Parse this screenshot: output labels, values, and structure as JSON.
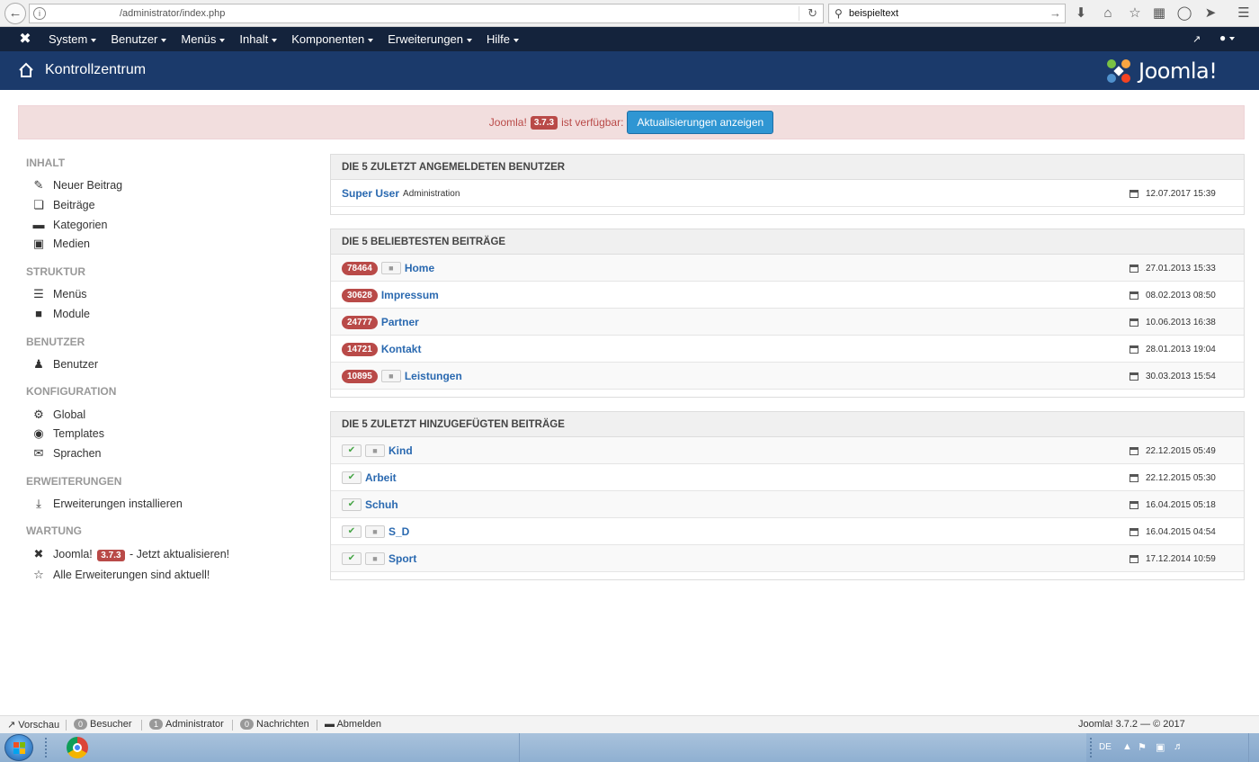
{
  "browser": {
    "url": "/administrator/index.php",
    "search_value": "beispieltext"
  },
  "navbar": {
    "items": [
      "System",
      "Benutzer",
      "Menüs",
      "Inhalt",
      "Komponenten",
      "Erweiterungen",
      "Hilfe"
    ]
  },
  "header": {
    "title": "Kontrollzentrum",
    "brand": "Joomla!"
  },
  "alert": {
    "prefix": "Joomla!",
    "version": "3.7.3",
    "suffix": "ist verfügbar:",
    "button": "Aktualisierungen anzeigen"
  },
  "sidebar": {
    "sections": [
      {
        "title": "INHALT",
        "items": [
          {
            "label": "Neuer Beitrag",
            "icon": "pencil-icon"
          },
          {
            "label": "Beiträge",
            "icon": "copy-icon"
          },
          {
            "label": "Kategorien",
            "icon": "folder-icon"
          },
          {
            "label": "Medien",
            "icon": "image-icon"
          }
        ]
      },
      {
        "title": "STRUKTUR",
        "items": [
          {
            "label": "Menüs",
            "icon": "list-icon"
          },
          {
            "label": "Module",
            "icon": "cube-icon"
          }
        ]
      },
      {
        "title": "BENUTZER",
        "items": [
          {
            "label": "Benutzer",
            "icon": "users-icon"
          }
        ]
      },
      {
        "title": "KONFIGURATION",
        "items": [
          {
            "label": "Global",
            "icon": "gear-icon"
          },
          {
            "label": "Templates",
            "icon": "eye-icon"
          },
          {
            "label": "Sprachen",
            "icon": "comments-icon"
          }
        ]
      },
      {
        "title": "ERWEITERUNGEN",
        "items": [
          {
            "label": "Erweiterungen installieren",
            "icon": "download-icon"
          }
        ]
      },
      {
        "title": "WARTUNG",
        "items": [
          {
            "label_prefix": "Joomla!",
            "version": "3.7.3",
            "label_suffix": "- Jetzt aktualisieren!",
            "icon": "joomla-icon"
          },
          {
            "label": "Alle Erweiterungen sind aktuell!",
            "icon": "star-icon"
          }
        ]
      }
    ]
  },
  "panels": {
    "logged_in": {
      "title": "DIE 5 ZULETZT ANGEMELDETEN BENUTZER",
      "rows": [
        {
          "name": "Super User",
          "sub": "Administration",
          "date": "12.07.2017 15:39"
        }
      ]
    },
    "popular": {
      "title": "DIE 5 BELIEBTESTEN BEITRÄGE",
      "rows": [
        {
          "hits": "78464",
          "locked": true,
          "title": "Home",
          "date": "27.01.2013 15:33"
        },
        {
          "hits": "30628",
          "locked": false,
          "title": "Impressum",
          "date": "08.02.2013 08:50"
        },
        {
          "hits": "24777",
          "locked": false,
          "title": "Partner",
          "date": "10.06.2013 16:38"
        },
        {
          "hits": "14721",
          "locked": false,
          "title": "Kontakt",
          "date": "28.01.2013 19:04"
        },
        {
          "hits": "10895",
          "locked": true,
          "title": "Leistungen",
          "date": "30.03.2013 15:54"
        }
      ]
    },
    "recent": {
      "title": "DIE 5 ZULETZT HINZUGEFÜGTEN BEITRÄGE",
      "rows": [
        {
          "locked": true,
          "title": "Kind",
          "date": "22.12.2015 05:49"
        },
        {
          "locked": false,
          "title": "Arbeit",
          "date": "22.12.2015 05:30"
        },
        {
          "locked": false,
          "title": "Schuh",
          "date": "16.04.2015 05:18"
        },
        {
          "locked": true,
          "title": "S_D",
          "date": "16.04.2015 04:54"
        },
        {
          "locked": true,
          "title": "Sport",
          "date": "17.12.2014 10:59"
        }
      ]
    }
  },
  "statusbar": {
    "preview": "Vorschau",
    "visitors_count": "0",
    "visitors": "Besucher",
    "admins_count": "1",
    "admins": "Administrator",
    "messages_count": "0",
    "messages": "Nachrichten",
    "logout": "Abmelden",
    "version": "Joomla! 3.7.2 — © 2017"
  },
  "taskbar": {
    "lang": "DE"
  },
  "colors": {
    "navbar": "#14233c",
    "titlebar": "#1b3a6b",
    "badge_red": "#b94a48",
    "link_blue": "#2a69b0",
    "button_blue": "#2f96d3"
  }
}
